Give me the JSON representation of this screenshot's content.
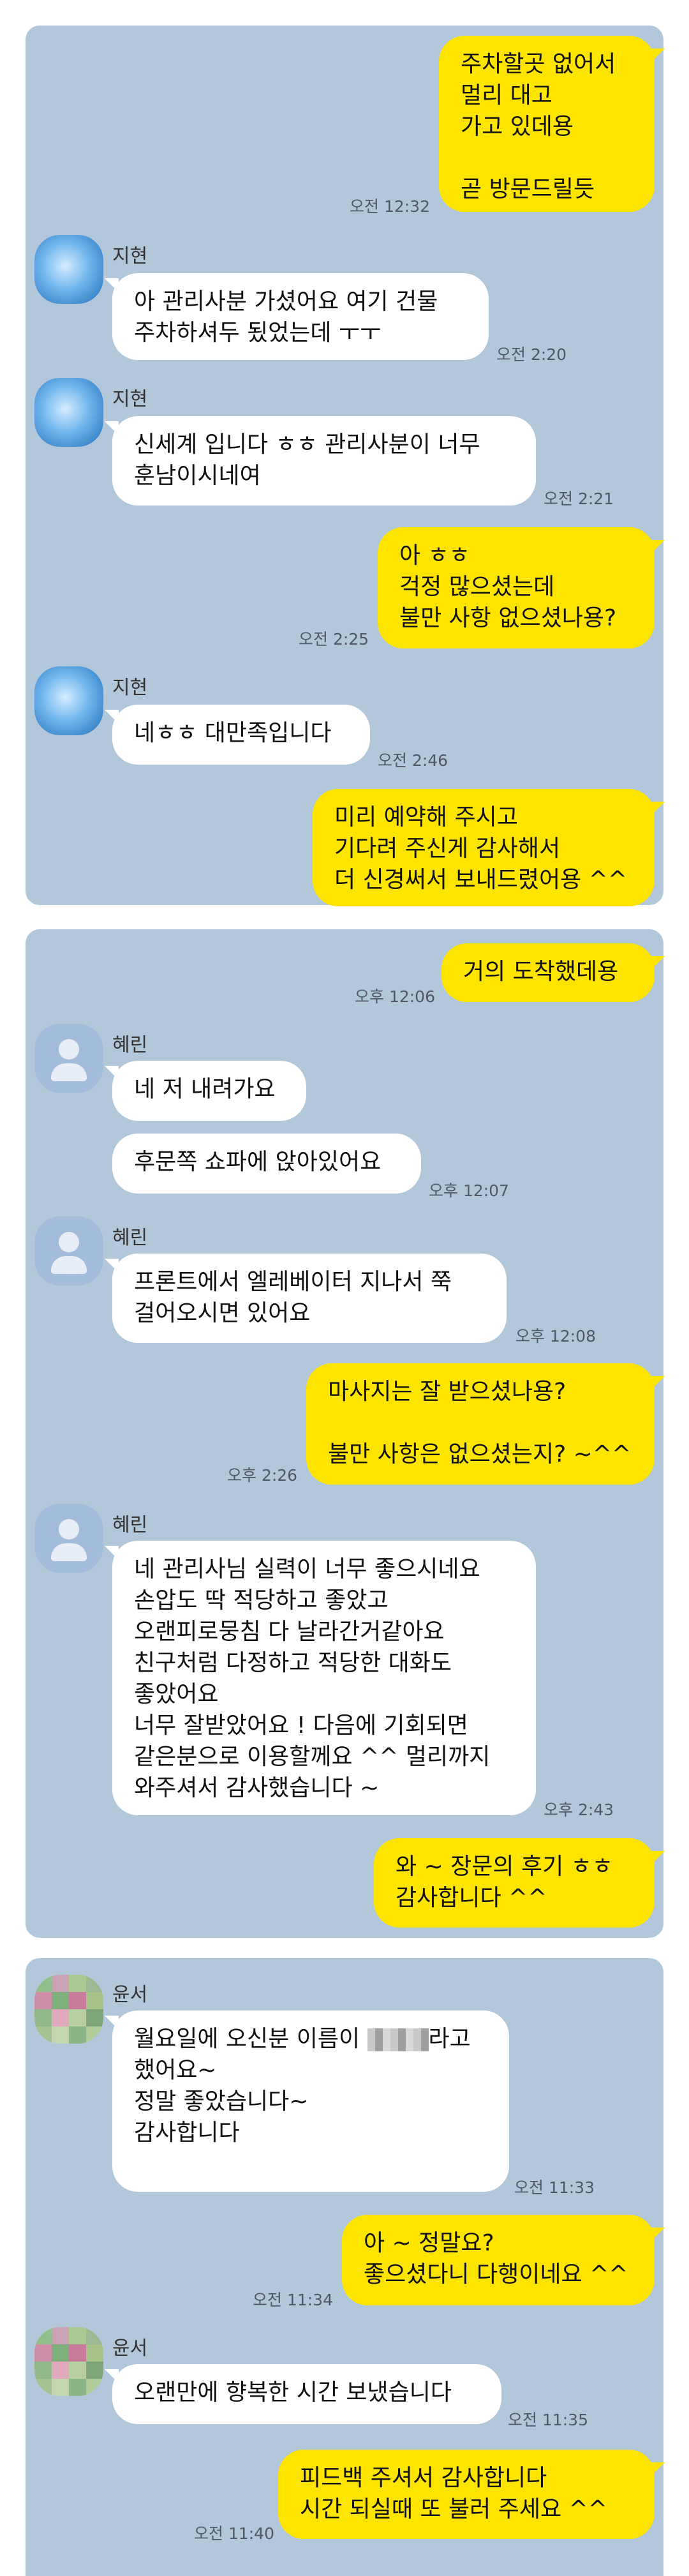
{
  "conversations": [
    {
      "messages": [
        {
          "type": "out",
          "text": "주차할곳 없어서\n멀리 대고\n가고 있데용\n\n곧 방문드릴듯",
          "time": "오전 12:32"
        },
        {
          "type": "in",
          "sender": "지현",
          "text": "아 관리사분 가셨어요 여기 건물\n주차하셔두 됬었는데 ㅜㅜ",
          "time": "오전 2:20"
        },
        {
          "type": "in",
          "sender": "지현",
          "text": "신세계 입니다 ㅎㅎ 관리사분이 너무\n훈남이시네여",
          "time": "오전 2:21"
        },
        {
          "type": "out",
          "text": "아 ㅎㅎ\n걱정 많으셨는데\n불만 사항 없으셨나용?",
          "time": "오전 2:25"
        },
        {
          "type": "in",
          "sender": "지현",
          "text": "네ㅎㅎ 대만족입니다",
          "time": "오전 2:46"
        },
        {
          "type": "out",
          "text": "미리 예약해 주시고\n기다려 주신게 감사해서\n더 신경써서 보내드렸어용 ^^",
          "time": ""
        }
      ]
    },
    {
      "messages": [
        {
          "type": "out",
          "text": "거의 도착했데용",
          "time": "오후 12:06"
        },
        {
          "type": "in",
          "sender": "혜린",
          "text": "네 저 내려가요",
          "time": ""
        },
        {
          "type": "in",
          "text": "후문쪽 쇼파에 앉아있어요",
          "time": "오후 12:07"
        },
        {
          "type": "in",
          "sender": "혜린",
          "text": "프론트에서 엘레베이터 지나서 쭉\n걸어오시면 있어요",
          "time": "오후 12:08"
        },
        {
          "type": "out",
          "text": "마사지는 잘 받으셨나용?\n\n불만 사항은 없으셨는지? ~^^",
          "time": "오후 2:26"
        },
        {
          "type": "in",
          "sender": "혜린",
          "text": "네 관리사님 실력이 너무 좋으시네요\n손압도 딱 적당하고 좋았고\n오랜피로뭉침 다 날라간거같아요\n친구처럼 다정하고 적당한 대화도\n좋았어요\n너무 잘받았어요 ! 다음에 기회되면\n같은분으로 이용할께요 ^^ 멀리까지\n와주셔서 감사했습니다 ~",
          "time": "오후 2:43"
        },
        {
          "type": "out",
          "text": "와 ~ 장문의 후기 ㅎㅎ\n감사합니다 ^^",
          "time": ""
        }
      ]
    },
    {
      "messages": [
        {
          "type": "in",
          "sender": "윤서",
          "text_before": "월요일에 오신분 이름이 ",
          "text_after": "라고\n했어요~\n정말 좋았습니다~\n감사합니다",
          "time": "오전 11:33"
        },
        {
          "type": "out",
          "text": "아 ~ 정말요?\n좋으셨다니 다행이네요 ^^",
          "time": "오전 11:34"
        },
        {
          "type": "in",
          "sender": "윤서",
          "text": "오랜만에 향복한 시간 보냈습니다",
          "time": "오전 11:35"
        },
        {
          "type": "out",
          "text": "피드백 주셔서 감사합니다\n시간 되실때 또 불러 주세요 ^^",
          "time": "오전 11:40"
        }
      ]
    }
  ],
  "colors": {
    "panel": "#b2c7d9",
    "bubble_out": "#fee500",
    "bubble_in": "#ffffff",
    "time": "#4e5965"
  },
  "icons": {
    "avatar_jihyun": "blurred-blue-avatar",
    "avatar_hyerin": "default-person-avatar",
    "avatar_yunseo": "mosaic-avatar"
  }
}
